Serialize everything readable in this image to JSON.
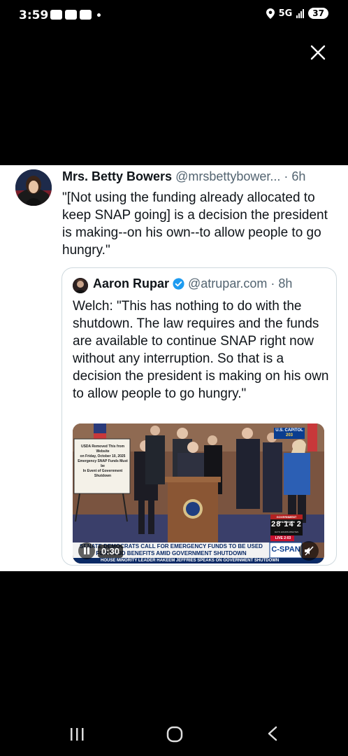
{
  "status_bar": {
    "time": "3:59",
    "network": "5G",
    "battery": "37"
  },
  "tweet": {
    "author_name": "Mrs. Betty Bowers",
    "author_handle": "@mrsbettybower...",
    "time_ago": "· 6h",
    "text": "\"[Not using the funding already allocated to keep SNAP going] is a decision the president is making--on his own--to allow people to go hungry.\""
  },
  "quoted_tweet": {
    "author_name": "Aaron Rupar",
    "author_handle": "@atrupar.com",
    "time_ago": "· 8h",
    "text": "Welch: \"This has nothing to do with the shutdown. The law requires and the funds are available to continue SNAP right now without any interruption. So that is a decision the president is making on his own to allow people to go hungry.\""
  },
  "video": {
    "duration": "0:30",
    "location_badge": "U.S. CAPITOL",
    "location_sub": "203",
    "shutdown_label": "GOVERNMENT SHUTDOWN",
    "countdown": "28 14 2",
    "countdown_units": "DAYS HOURS MINUTES",
    "live_label": "LIVE",
    "live_time": "2:03",
    "chyron_line1": "SENATE DEMOCRATS CALL FOR EMERGENCY FUNDS TO BE USED",
    "chyron_line2": "FOR FOOD BENEFITS AMID GOVERNMENT SHUTDOWN",
    "ticker": "HOUSE MINORITY LEADER HAKEEM JEFFRIES SPEAKS ON GOVERNMENT SHUTDOWN",
    "network_logo": "C-SPAN",
    "sign_line1": "USDA Removed This from Website",
    "sign_line2": "on Friday, October 10, 2025",
    "sign_line3": "Emergency SNAP Funds Must be",
    "sign_line4": "In Event of Government Shutdown"
  },
  "colors": {
    "card_bg": "#ffffff",
    "secondary_text": "#536471",
    "verified_blue": "#1d9bf0",
    "cspan_blue": "#0a3d8f"
  }
}
